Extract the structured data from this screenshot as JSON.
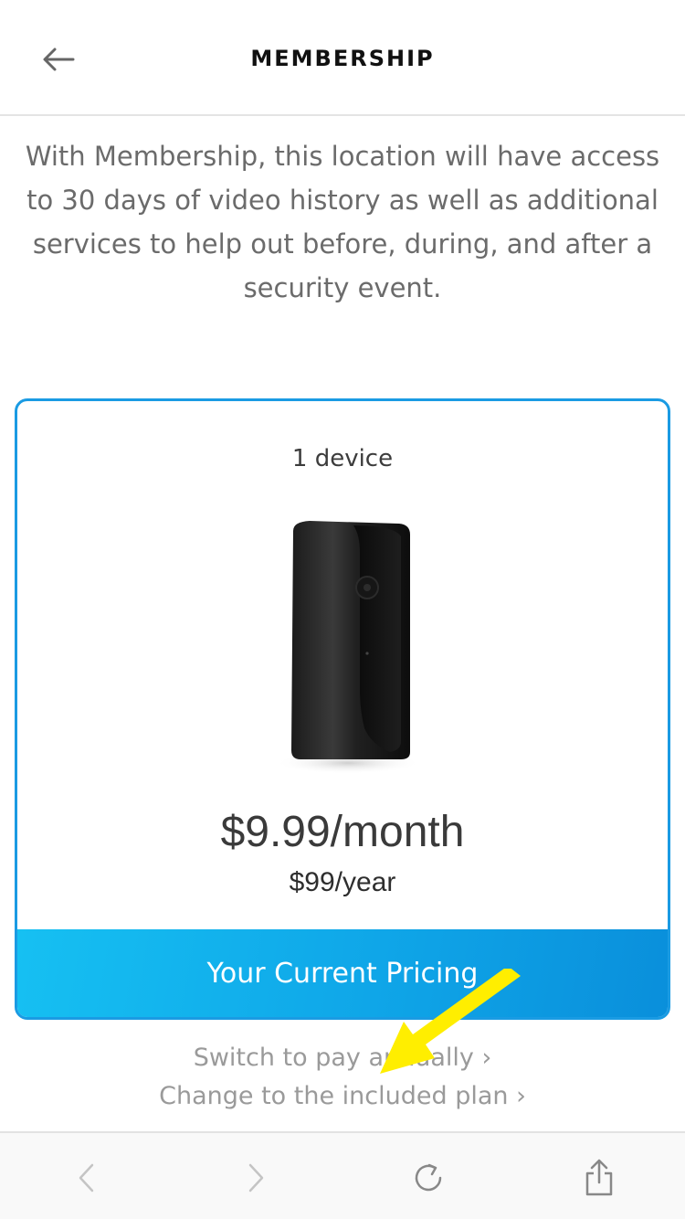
{
  "header": {
    "title": "MEMBERSHIP",
    "back_icon": "arrow-left-icon"
  },
  "intro": {
    "text": "With Membership, this location will have access to 30 days of video history as well as additional services to help out before, during, and after a security event."
  },
  "plan_card": {
    "devices_label": "1 device",
    "image": "security-camera",
    "price_monthly": "$9.99/month",
    "price_yearly": "$99/year",
    "status_label": "Your Current Pricing",
    "accent_color": "#1a9be3"
  },
  "links": {
    "switch_annually": "Switch to pay annually ›",
    "change_plan": "Change to the included plan ›"
  },
  "annotation": {
    "icon": "yellow-arrow-icon",
    "color": "#ffee00"
  },
  "browser_toolbar": {
    "back_icon": "chevron-left-icon",
    "forward_icon": "chevron-right-icon",
    "reload_icon": "reload-icon",
    "share_icon": "share-icon"
  }
}
